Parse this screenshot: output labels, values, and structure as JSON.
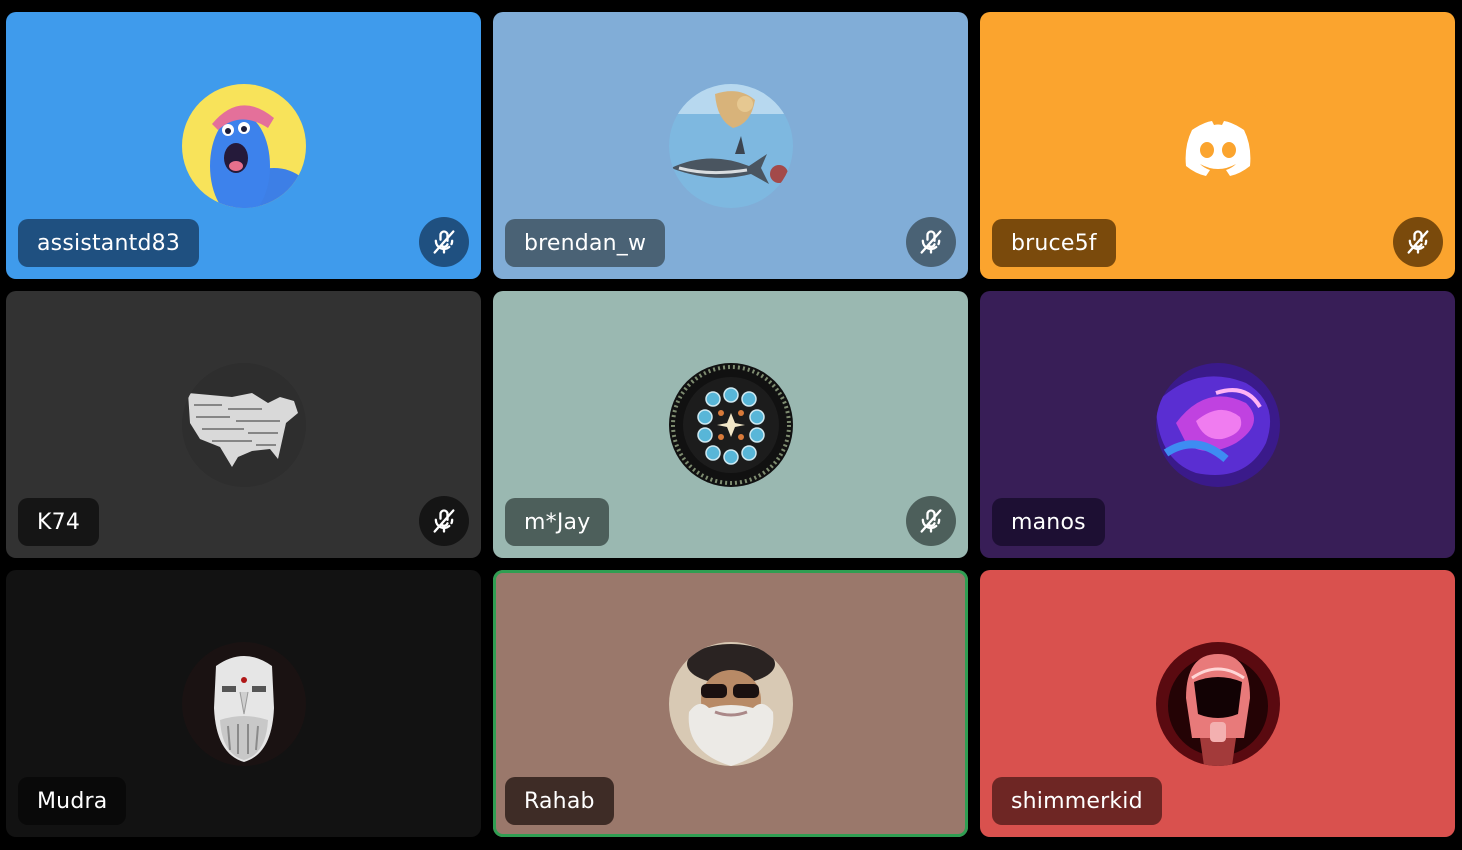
{
  "participants": [
    {
      "name": "assistantd83",
      "muted": true,
      "speaking": false,
      "tile_color": "#3f9bec",
      "avatar": "blue-cartoon-avatar"
    },
    {
      "name": "brendan_w",
      "muted": true,
      "speaking": false,
      "tile_color": "#81add7",
      "avatar": "underwater-animals-avatar"
    },
    {
      "name": "bruce5f",
      "muted": true,
      "speaking": false,
      "tile_color": "#fba42e",
      "avatar": "discord-logo-avatar"
    },
    {
      "name": "K74",
      "muted": true,
      "speaking": false,
      "tile_color": "#323232",
      "avatar": "map-avatar"
    },
    {
      "name": "m*Jay",
      "muted": true,
      "speaking": false,
      "tile_color": "#9ab8b1",
      "avatar": "mandala-avatar"
    },
    {
      "name": "manos",
      "muted": false,
      "speaking": false,
      "tile_color": "#381e57",
      "avatar": "abstract-swirl-avatar"
    },
    {
      "name": "Mudra",
      "muted": false,
      "speaking": false,
      "tile_color": "#121212",
      "avatar": "mask-avatar"
    },
    {
      "name": "Rahab",
      "muted": false,
      "speaking": true,
      "tile_color": "#9a786b",
      "avatar": "bearded-man-avatar"
    },
    {
      "name": "shimmerkid",
      "muted": false,
      "speaking": false,
      "tile_color": "#d9514e",
      "avatar": "helmet-avatar"
    }
  ],
  "colors": {
    "speaking_border": "#2f9e52",
    "background": "#000000"
  },
  "icons": {
    "mute": "mic-muted-icon"
  }
}
